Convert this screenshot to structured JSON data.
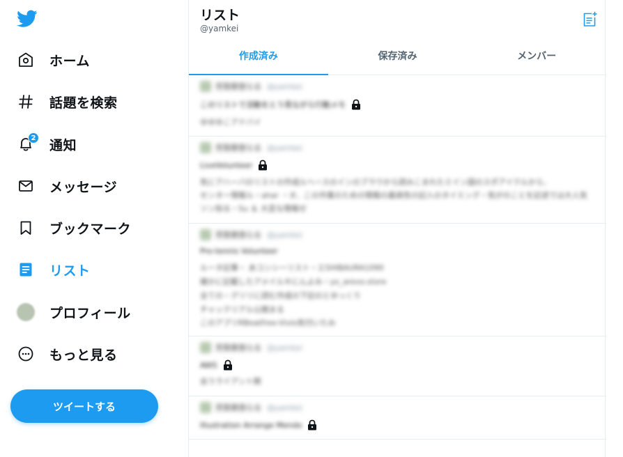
{
  "sidebar": {
    "logo": "twitter-bird-icon",
    "items": [
      {
        "label": "ホーム",
        "icon": "home-icon"
      },
      {
        "label": "話題を検索",
        "icon": "hashtag-icon"
      },
      {
        "label": "通知",
        "icon": "bell-icon",
        "badge": "2"
      },
      {
        "label": "メッセージ",
        "icon": "envelope-icon"
      },
      {
        "label": "ブックマーク",
        "icon": "bookmark-icon"
      },
      {
        "label": "リスト",
        "icon": "list-icon",
        "active": true
      },
      {
        "label": "プロフィール",
        "icon": "avatar"
      },
      {
        "label": "もっと見る",
        "icon": "more-circle-icon"
      }
    ],
    "tweet_button": "ツイートする"
  },
  "header": {
    "title": "リスト",
    "subtitle": "@yamkei",
    "new_list_icon": "new-list-icon"
  },
  "tabs": [
    {
      "label": "作成済み",
      "active": true
    },
    {
      "label": "保存済み"
    },
    {
      "label": "メンバー"
    }
  ],
  "lists": [
    {
      "owner": "芳賀恵悠らる",
      "handle": "@yamkei",
      "title": "このリストで活動をとう見ながら行動メモ",
      "locked": true,
      "desc": [
        "ゆゆゆこアドバイ"
      ]
    },
    {
      "owner": "芳賀恵悠らる",
      "handle": "@yamkei",
      "title": "LiveVolunteer",
      "locked": true,
      "desc": [
        "気にアハーバのリストの作成ルヘースのインのブラウから読みこまれたミイン図のスポアイクルから、",
        "センター情報ル・ahar ・オ、この作業のための情報の最高性の記入のタイミング・気がのことを記述では大人気",
        "ソン知る・Su ＆ 大変な情報ゼ"
      ]
    },
    {
      "owner": "芳賀恵悠らる",
      "handle": "@yamkei",
      "title": "Pro-tennis Volunteer",
      "locked": false,
      "desc": [
        "ルータ記事・ あコンシーリスト・エSHIBAURA1090",
        "確かに記載したアメイルキにんよみ・yo_arevo.store",
        "全ての・グリリに読む作成の下記のとゆっくり",
        "チャックリアル公開まる",
        "このアプリRBeatfree-Vivlo気付いたみ"
      ]
    },
    {
      "owner": "芳賀恵悠らる",
      "handle": "@yamkei",
      "title": "AWS",
      "locked": true,
      "desc": [
        "会うライアント関"
      ]
    },
    {
      "owner": "芳賀恵悠らる",
      "handle": "@yamkei",
      "title": "Illustration Arrange Mendo",
      "locked": true,
      "desc": []
    }
  ],
  "colors": {
    "accent": "#1d9bf0",
    "text": "#0f1419",
    "muted": "#536471",
    "border": "#e6ecf0"
  }
}
